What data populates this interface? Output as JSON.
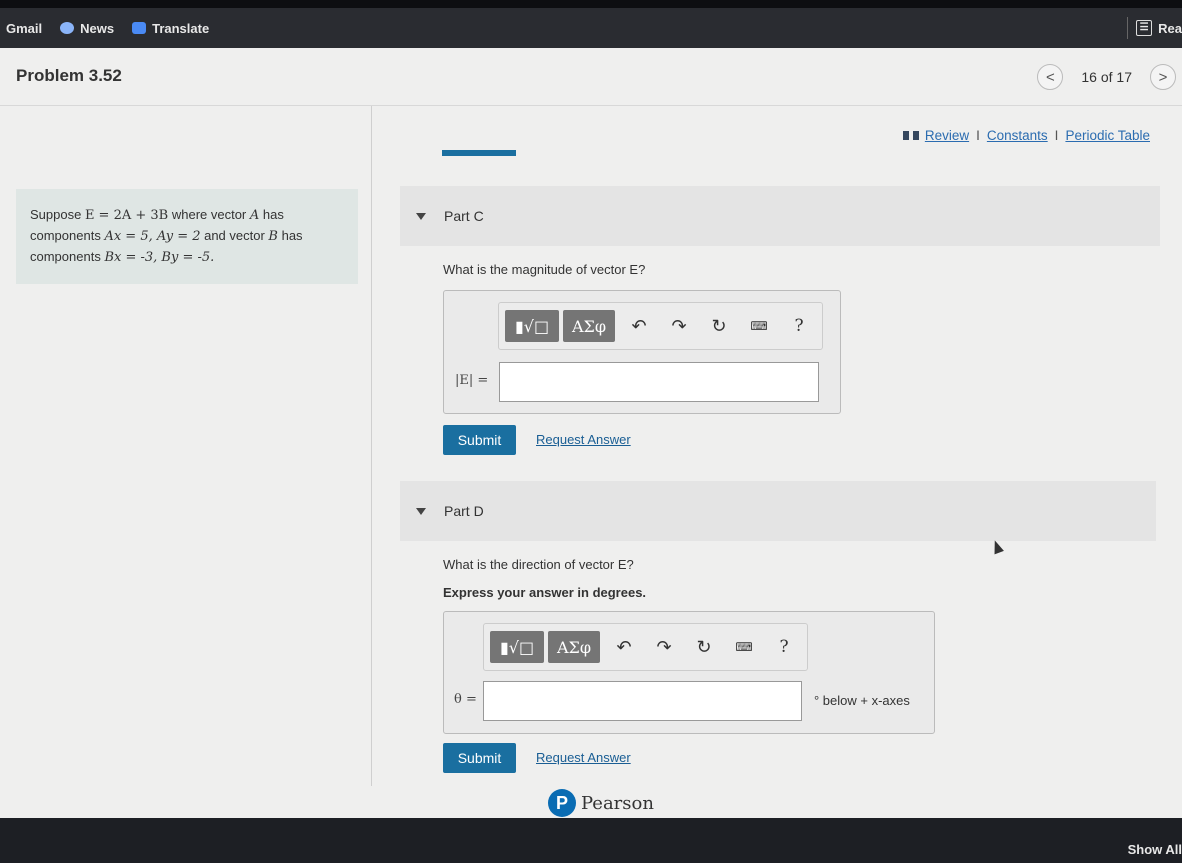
{
  "bookmarks": [
    {
      "label": "Gmail",
      "icon": "gmail-icon"
    },
    {
      "label": "News",
      "icon": "news-icon"
    },
    {
      "label": "Translate",
      "icon": "translate-icon"
    }
  ],
  "reading_list_label": "Rea",
  "problem": {
    "title": "Problem 3.52",
    "nav": {
      "count": "16 of 17",
      "prev": "<",
      "next": ">"
    },
    "statement": {
      "s1": "Suppose ",
      "eq1": "E = 2A + 3B",
      "s2": " where vector ",
      "vecA": "A",
      "s3": " has components ",
      "comps_A": "Ax = 5, Ay = 2",
      "s4": " and vector ",
      "vecB": "B",
      "s5": " has components ",
      "comps_B": "Bx = -3, By = -5."
    }
  },
  "links": {
    "review": "Review",
    "constants": "Constants",
    "periodic": "Periodic Table",
    "sep": "I"
  },
  "partC": {
    "label": "Part C",
    "question": "What is the magnitude of vector E?",
    "var_label": "|E| =",
    "toolbar": {
      "btn1": "▮√□",
      "btn2": "ΑΣφ",
      "undo": "↶",
      "redo": "↷",
      "reset": "↻",
      "keyboard": "⌨",
      "help": "?"
    },
    "submit": "Submit",
    "request": "Request Answer"
  },
  "partD": {
    "label": "Part D",
    "question": "What is the direction of vector E?",
    "instruction": "Express your answer in degrees.",
    "var_label": "θ =",
    "unit": "° below + x-axes",
    "toolbar": {
      "btn1": "▮√□",
      "btn2": "ΑΣφ",
      "undo": "↶",
      "redo": "↷",
      "reset": "↻",
      "keyboard": "⌨",
      "help": "?"
    },
    "submit": "Submit",
    "request": "Request Answer"
  },
  "footer": {
    "brand": "Pearson",
    "logo_letter": "P"
  },
  "taskbar": {
    "show_all": "Show All"
  }
}
